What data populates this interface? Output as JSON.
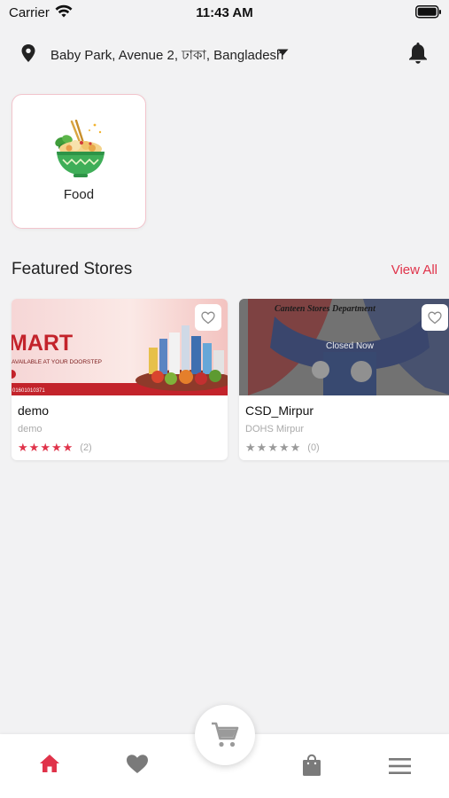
{
  "status_bar": {
    "carrier": "Carrier",
    "time": "11:43 AM"
  },
  "header": {
    "location": "Baby Park, Avenue 2, ঢাকা, Bangladesh",
    "location_icon": "location-pin-icon",
    "dropdown_icon": "caret-down-icon",
    "notification_icon": "bell-icon"
  },
  "categories": [
    {
      "label": "Food",
      "icon": "food-bowl-icon"
    }
  ],
  "featured": {
    "title": "Featured Stores",
    "view_all": "View All",
    "stores": [
      {
        "name": "demo",
        "subtitle": "demo",
        "rating": 5,
        "rating_count": "(2)",
        "banner_title": "MART",
        "banner_tagline": "AVAILABLE AT YOUR DOORSTEP",
        "banner_phone": "01601010371",
        "status": ""
      },
      {
        "name": "CSD_Mirpur",
        "subtitle": "DOHS Mirpur",
        "rating": 0,
        "rating_count": "(0)",
        "banner_title": "Canteen Stores Department",
        "status": "Closed Now"
      }
    ]
  },
  "tab_bar": {
    "items": [
      "home-icon",
      "heart-icon",
      "cart-icon",
      "bag-icon",
      "menu-icon"
    ],
    "active": "home-icon"
  },
  "colors": {
    "accent": "#e0334a",
    "background": "#f2f2f3",
    "inactive_icon": "#7a7a7a",
    "star_empty": "#9a9a9a"
  }
}
